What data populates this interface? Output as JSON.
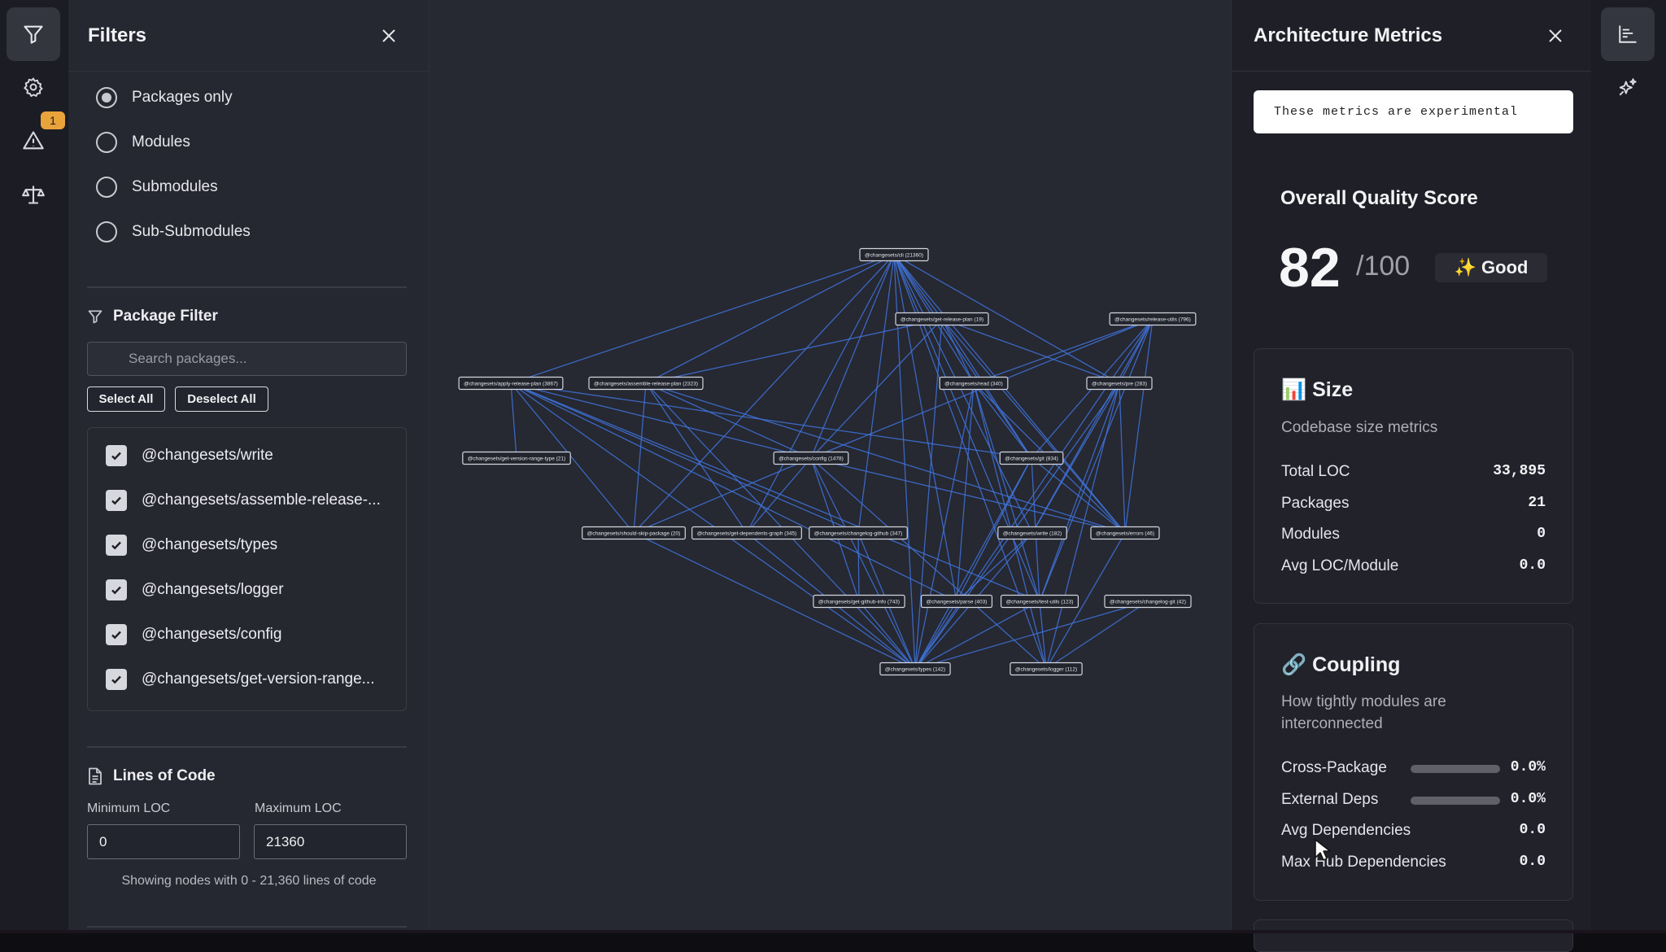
{
  "left_rail": {
    "icons": [
      "filter-icon",
      "gear-icon",
      "warning-icon",
      "balance-scale-icon"
    ],
    "warning_badge": "1"
  },
  "filters": {
    "title": "Filters",
    "granularity_options": [
      {
        "label": "Packages only",
        "selected": true
      },
      {
        "label": "Modules",
        "selected": false
      },
      {
        "label": "Submodules",
        "selected": false
      },
      {
        "label": "Sub-Submodules",
        "selected": false
      }
    ],
    "package_filter": {
      "heading": "Package Filter",
      "search_placeholder": "Search packages...",
      "select_all": "Select All",
      "deselect_all": "Deselect All",
      "packages": [
        {
          "label": "@changesets/write",
          "checked": true
        },
        {
          "label": "@changesets/assemble-release-...",
          "checked": true
        },
        {
          "label": "@changesets/types",
          "checked": true
        },
        {
          "label": "@changesets/logger",
          "checked": true
        },
        {
          "label": "@changesets/config",
          "checked": true
        },
        {
          "label": "@changesets/get-version-range...",
          "checked": true
        }
      ]
    },
    "loc": {
      "heading": "Lines of Code",
      "min_label": "Minimum LOC",
      "max_label": "Maximum LOC",
      "min_value": "0",
      "max_value": "21360",
      "hint": "Showing nodes with 0 - 21,360 lines of code"
    }
  },
  "graph": {
    "nodes": [
      {
        "id": "cli",
        "label": "@changesets/cli (21360)"
      },
      {
        "id": "grp",
        "label": "@changesets/get-release-plan (19)"
      },
      {
        "id": "rel",
        "label": "@changesets/release-utils (796)"
      },
      {
        "id": "arp",
        "label": "@changesets/apply-release-plan (3867)"
      },
      {
        "id": "asm",
        "label": "@changesets/assemble-release-plan (2323)"
      },
      {
        "id": "read",
        "label": "@changesets/read (340)"
      },
      {
        "id": "pre",
        "label": "@changesets/pre (283)"
      },
      {
        "id": "gvr",
        "label": "@changesets/get-version-range-type (21)"
      },
      {
        "id": "cfg",
        "label": "@changesets/config (1478)"
      },
      {
        "id": "git",
        "label": "@changesets/git (834)"
      },
      {
        "id": "ssp",
        "label": "@changesets/should-skip-package (20)"
      },
      {
        "id": "gdg",
        "label": "@changesets/get-dependents-graph (345)"
      },
      {
        "id": "chg",
        "label": "@changesets/changelog-github (347)"
      },
      {
        "id": "wr",
        "label": "@changesets/write (182)"
      },
      {
        "id": "err",
        "label": "@changesets/errors (46)"
      },
      {
        "id": "ghi",
        "label": "@changesets/get-github-info (743)"
      },
      {
        "id": "prs",
        "label": "@changesets/parse (403)"
      },
      {
        "id": "tu",
        "label": "@changesets/test-utils (123)"
      },
      {
        "id": "cgg",
        "label": "@changesets/changelog-git (42)"
      },
      {
        "id": "typ",
        "label": "@changesets/types (142)"
      },
      {
        "id": "log",
        "label": "@changesets/logger (112)"
      }
    ],
    "edges": [
      [
        "cli",
        "grp"
      ],
      [
        "cli",
        "arp"
      ],
      [
        "cli",
        "asm"
      ],
      [
        "cli",
        "read"
      ],
      [
        "cli",
        "pre"
      ],
      [
        "cli",
        "cfg"
      ],
      [
        "cli",
        "git"
      ],
      [
        "cli",
        "wr"
      ],
      [
        "cli",
        "err"
      ],
      [
        "cli",
        "typ"
      ],
      [
        "cli",
        "log"
      ],
      [
        "cli",
        "ssp"
      ],
      [
        "cli",
        "gdg"
      ],
      [
        "cli",
        "tu"
      ],
      [
        "cli",
        "prs"
      ],
      [
        "cli",
        "chg"
      ],
      [
        "grp",
        "asm"
      ],
      [
        "grp",
        "read"
      ],
      [
        "grp",
        "pre"
      ],
      [
        "grp",
        "cfg"
      ],
      [
        "grp",
        "typ"
      ],
      [
        "grp",
        "git"
      ],
      [
        "grp",
        "err"
      ],
      [
        "rel",
        "read"
      ],
      [
        "rel",
        "pre"
      ],
      [
        "rel",
        "cfg"
      ],
      [
        "rel",
        "git"
      ],
      [
        "rel",
        "wr"
      ],
      [
        "rel",
        "err"
      ],
      [
        "rel",
        "typ"
      ],
      [
        "rel",
        "tu"
      ],
      [
        "arp",
        "gvr"
      ],
      [
        "arp",
        "cfg"
      ],
      [
        "arp",
        "git"
      ],
      [
        "arp",
        "ssp"
      ],
      [
        "arp",
        "chg"
      ],
      [
        "arp",
        "typ"
      ],
      [
        "arp",
        "tu"
      ],
      [
        "arp",
        "prs"
      ],
      [
        "asm",
        "ssp"
      ],
      [
        "asm",
        "gdg"
      ],
      [
        "asm",
        "err"
      ],
      [
        "asm",
        "typ"
      ],
      [
        "asm",
        "cfg"
      ],
      [
        "read",
        "git"
      ],
      [
        "read",
        "prs"
      ],
      [
        "read",
        "typ"
      ],
      [
        "read",
        "log"
      ],
      [
        "read",
        "tu"
      ],
      [
        "read",
        "err"
      ],
      [
        "pre",
        "err"
      ],
      [
        "pre",
        "typ"
      ],
      [
        "pre",
        "log"
      ],
      [
        "pre",
        "wr"
      ],
      [
        "pre",
        "tu"
      ],
      [
        "cfg",
        "ssp"
      ],
      [
        "cfg",
        "gdg"
      ],
      [
        "cfg",
        "err"
      ],
      [
        "cfg",
        "typ"
      ],
      [
        "cfg",
        "log"
      ],
      [
        "cfg",
        "ghi"
      ],
      [
        "git",
        "err"
      ],
      [
        "git",
        "typ"
      ],
      [
        "git",
        "tu"
      ],
      [
        "git",
        "prs"
      ],
      [
        "chg",
        "ghi"
      ],
      [
        "chg",
        "typ"
      ],
      [
        "wr",
        "typ"
      ],
      [
        "wr",
        "prs"
      ],
      [
        "ssp",
        "typ"
      ],
      [
        "gdg",
        "typ"
      ],
      [
        "ghi",
        "typ"
      ],
      [
        "prs",
        "typ"
      ],
      [
        "tu",
        "typ"
      ],
      [
        "tu",
        "log"
      ],
      [
        "cgg",
        "typ"
      ],
      [
        "cgg",
        "log"
      ],
      [
        "err",
        "log"
      ]
    ]
  },
  "metrics": {
    "title": "Architecture Metrics",
    "notice": "These metrics are experimental",
    "quality": {
      "title": "Overall Quality Score",
      "score": "82",
      "max": "/100",
      "grade": "✨ Good"
    },
    "size": {
      "heading": "📊 Size",
      "subtitle": "Codebase size metrics",
      "rows": [
        {
          "label": "Total LOC",
          "value": "33,895"
        },
        {
          "label": "Packages",
          "value": "21"
        },
        {
          "label": "Modules",
          "value": "0"
        },
        {
          "label": "Avg LOC/Module",
          "value": "0.0"
        }
      ]
    },
    "coupling": {
      "heading": "🔗 Coupling",
      "subtitle": "How tightly modules are interconnected",
      "rows": [
        {
          "label": "Cross-Package",
          "value": "0.0%",
          "fraction": 0.0
        },
        {
          "label": "External Deps",
          "value": "0.0%",
          "fraction": 0.0
        },
        {
          "label": "Avg Dependencies",
          "value": "0.0"
        },
        {
          "label": "Max Hub Dependencies",
          "value": "0.0"
        }
      ]
    }
  },
  "right_rail": {
    "icons": [
      "bar-chart-icon",
      "sparkles-icon"
    ]
  }
}
